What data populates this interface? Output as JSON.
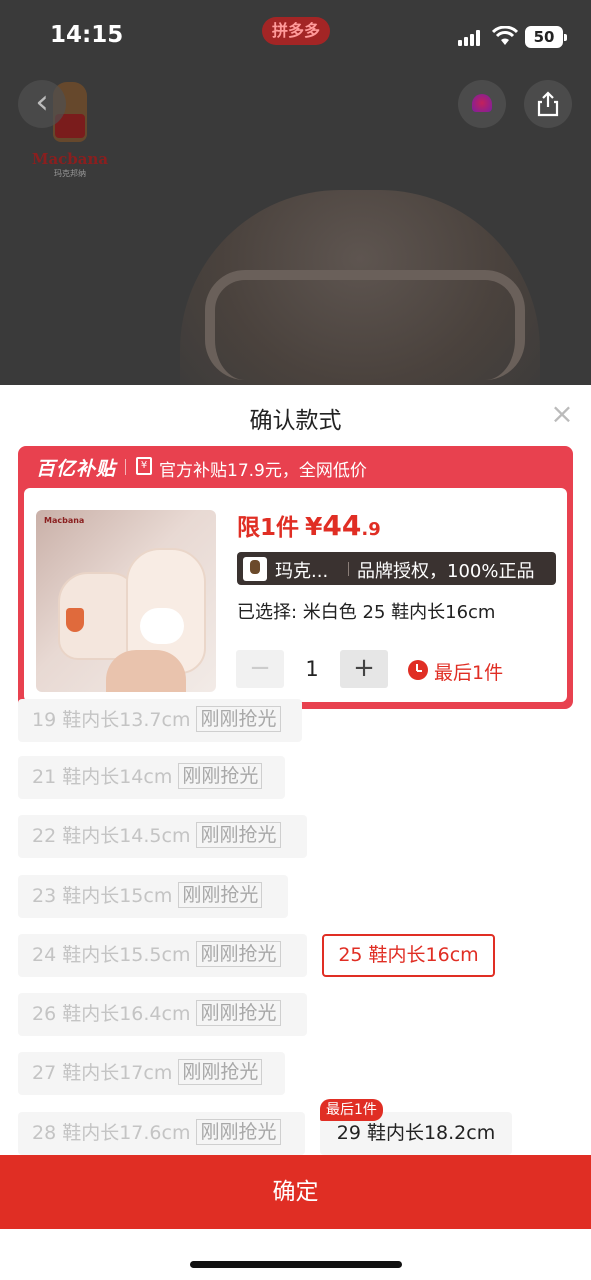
{
  "status_bar": {
    "time": "14:15",
    "app_badge": "拼多多",
    "battery": "50"
  },
  "header": {
    "brand_logo_text": "Macbana",
    "brand_logo_sub": "玛克邦纳",
    "back_icon": "chevron-left-icon",
    "share_icon": "share-icon"
  },
  "sheet": {
    "title": "确认款式",
    "close_icon": "×"
  },
  "promo": {
    "logo": "百亿补贴",
    "text": "官方补贴17.9元，全网低价"
  },
  "product": {
    "limit_label": "限1件",
    "currency": "¥",
    "price_int": "44",
    "price_dec": ".9",
    "brand_name": "玛克...",
    "auth_text": "品牌授权，100%正品",
    "selected_text": "已选择: 米白色 25 鞋内长16cm",
    "minus": "−",
    "quantity": "1",
    "plus": "+",
    "stock_note": "最后1件"
  },
  "sizes": {
    "soldout_label": "刚刚抢光",
    "s19": "19 鞋内长13.7cm",
    "s21": "21 鞋内长14cm",
    "s22": "22 鞋内长14.5cm",
    "s23": "23 鞋内长15cm",
    "s24": "24 鞋内长15.5cm",
    "s25": "25 鞋内长16cm",
    "s26": "26 鞋内长16.4cm",
    "s27": "27 鞋内长17cm",
    "s28": "28 鞋内长17.6cm",
    "s29": "29 鞋内长18.2cm",
    "s29_tag": "最后1件"
  },
  "footer": {
    "confirm_label": "确定"
  },
  "colors": {
    "accent": "#e02e24",
    "promo": "#e8414f",
    "backdrop": "#3a3a3a"
  }
}
